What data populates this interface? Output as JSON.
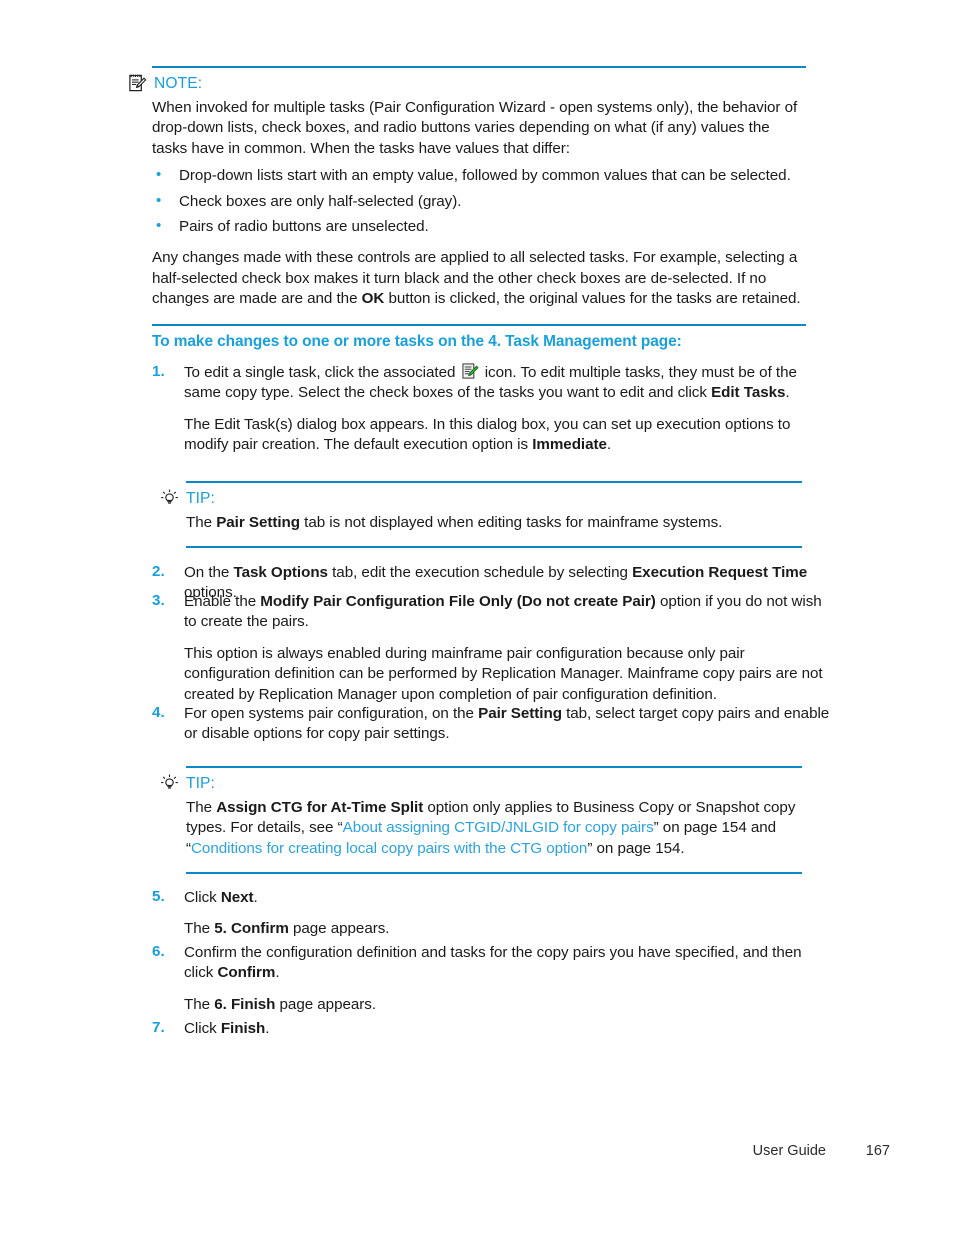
{
  "document": {
    "type": "user-guide-page",
    "accent_color": "#17a0dc",
    "rule_color": "#0f87c4",
    "link_color": "#2aa3e0",
    "text_color": "#1a1a1a"
  },
  "note": {
    "icon": "note-pad-icon",
    "label": "NOTE:",
    "paragraph_1": "When invoked for multiple tasks (Pair Configuration Wizard - open systems only), the behavior of drop-down lists, check boxes, and radio buttons varies depending on what (if any) values the tasks have in common. When the tasks have values that differ:",
    "bullets": [
      "Drop-down lists start with an empty value, followed by common values that can be selected.",
      "Check boxes are only half-selected (gray).",
      "Pairs of radio buttons are unselected."
    ],
    "paragraph_2_part_1": "Any changes made with these controls are applied to all selected tasks. For example, selecting a half-selected check box makes it turn black and the other check boxes are de-selected. If no changes are made are and the ",
    "paragraph_2_bold": "OK",
    "paragraph_2_part_2": " button is clicked, the original values for the tasks are retained."
  },
  "section": {
    "heading": "To make changes to one or more tasks on the 4. Task Management page:"
  },
  "steps": [
    {
      "number": "1.",
      "para_1_part_1": "To edit a single task, click the associated ",
      "para_1_icon": "edit-task-icon",
      "para_1_part_2": " icon. To edit multiple tasks, they must be of the same copy type. Select the check boxes of the tasks you want to edit and click ",
      "para_1_bold": "Edit Tasks",
      "para_1_part_3": ".",
      "para_2_part_1": "The Edit Task(s) dialog box appears. In this dialog box, you can set up execution options to modify pair creation. The default execution option is ",
      "para_2_bold": "Immediate",
      "para_2_part_2": "."
    },
    {
      "number": "2.",
      "para_1_part_1": "On the ",
      "para_1_bold_1": "Task Options",
      "para_1_part_2": " tab, edit the execution schedule by selecting ",
      "para_1_bold_2": "Execution Request Time",
      "para_1_part_3": " options."
    },
    {
      "number": "3.",
      "para_1_part_1": "Enable the ",
      "para_1_bold": "Modify Pair Configuration File Only (Do not create Pair)",
      "para_1_part_2": " option if you do not wish to create the pairs.",
      "para_2": "This option is always enabled during mainframe pair configuration because only pair configuration definition can be performed by Replication Manager. Mainframe copy pairs are not created by Replication Manager upon completion of pair configuration definition."
    },
    {
      "number": "4.",
      "para_1_part_1": "For open systems pair configuration, on the ",
      "para_1_bold": "Pair Setting",
      "para_1_part_2": " tab, select target copy pairs and enable or disable options for copy pair settings."
    },
    {
      "number": "5.",
      "para_1_part_1": "Click ",
      "para_1_bold": "Next",
      "para_1_part_2": ".",
      "para_2_part_1": "The ",
      "para_2_bold": "5. Confirm",
      "para_2_part_2": " page appears."
    },
    {
      "number": "6.",
      "para_1_part_1": "Confirm the configuration definition and tasks for the copy pairs you have specified, and then click ",
      "para_1_bold": "Confirm",
      "para_1_part_2": ".",
      "para_2_part_1": "The ",
      "para_2_bold": "6. Finish",
      "para_2_part_2": " page appears."
    },
    {
      "number": "7.",
      "para_1_part_1": "Click ",
      "para_1_bold": "Finish",
      "para_1_part_2": "."
    }
  ],
  "tips": [
    {
      "icon": "lightbulb-icon",
      "label": "TIP:",
      "body_part_1": "The ",
      "body_bold": "Pair Setting",
      "body_part_2": " tab is not displayed when editing tasks for mainframe systems."
    },
    {
      "icon": "lightbulb-icon",
      "label": "TIP:",
      "body_part_1": "The ",
      "body_bold": "Assign CTG  for At-Time Split",
      "body_part_2": " option only applies to Business Copy or Snapshot copy types. For details, see “",
      "link_1": "About assigning CTGID/JNLGID for copy pairs",
      "body_part_3": "” on page 154 and “",
      "link_2": "Conditions for creating local copy pairs with the CTG option",
      "body_part_4": "” on page 154."
    }
  ],
  "footer": {
    "guide_label": "User Guide",
    "page_number": "167"
  }
}
